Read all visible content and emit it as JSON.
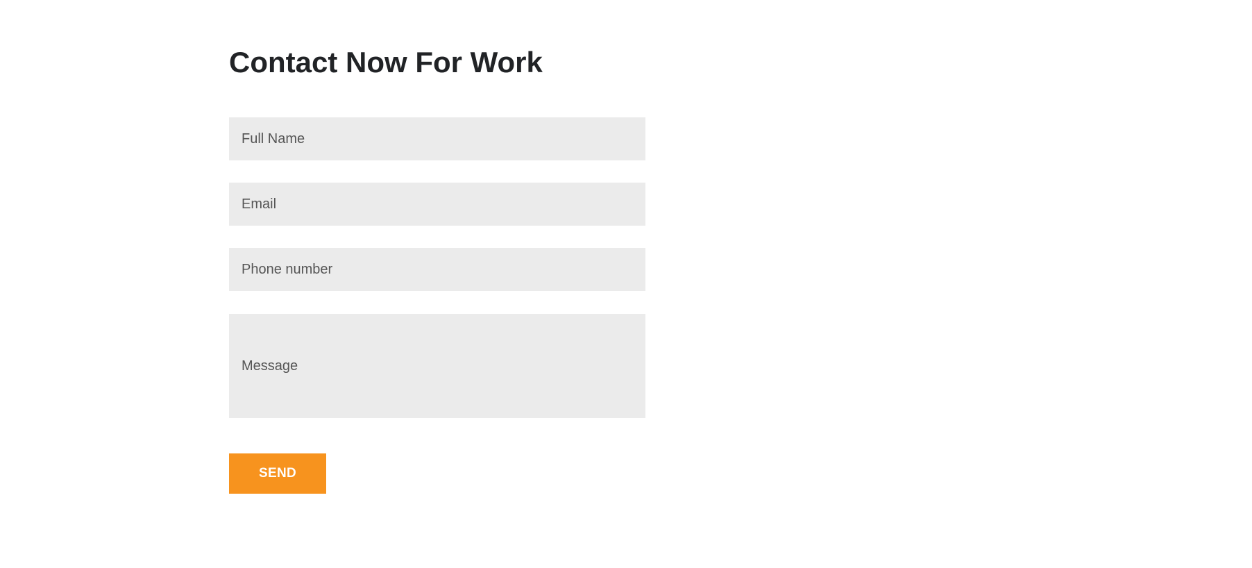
{
  "contact": {
    "title": "Contact Now For Work",
    "fields": {
      "full_name": {
        "placeholder": "Full Name",
        "value": ""
      },
      "email": {
        "placeholder": "Email",
        "value": ""
      },
      "phone": {
        "placeholder": "Phone number",
        "value": ""
      },
      "message": {
        "placeholder": "Message",
        "value": ""
      }
    },
    "send_label": "SEND"
  },
  "colors": {
    "accent": "#f7931e",
    "field_background": "#ebebeb",
    "title_text": "#212326"
  }
}
